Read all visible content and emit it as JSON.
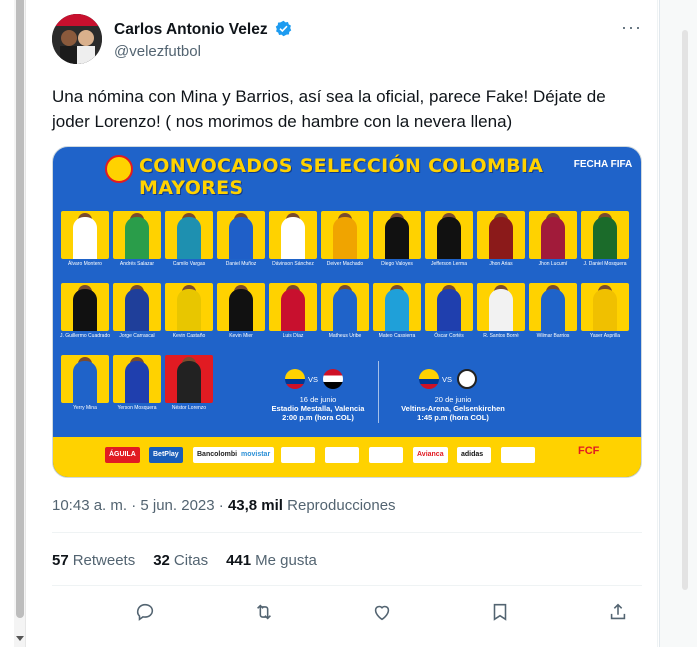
{
  "tweet": {
    "author_name": "Carlos Antonio Velez",
    "handle": "@velezfutbol",
    "text": "Una nómina con Mina y Barrios, así sea la oficial, parece Fake! Déjate de joder Lorenzo! ( nos morimos de hambre con la nevera llena)",
    "more_glyph": "···",
    "time": "10:43 a. m. · 5 jun. 2023 · ",
    "views_count": "43,8 mil",
    "views_label": " Reproducciones",
    "stats": [
      {
        "count": "57",
        "label": "Retweets"
      },
      {
        "count": "32",
        "label": "Citas"
      },
      {
        "count": "441",
        "label": "Me gusta"
      }
    ]
  },
  "actions": [
    {
      "name": "reply-icon"
    },
    {
      "name": "retweet-icon"
    },
    {
      "name": "like-icon"
    },
    {
      "name": "bookmark-icon"
    },
    {
      "name": "share-icon"
    }
  ],
  "media": {
    "title": "CONVOCADOS SELECCIÓN COLOMBIA MAYORES",
    "fecha": "FECHA FIFA",
    "players_row1": [
      "Álvaro Montero",
      "Andrés Salazar",
      "Camilo Vargas",
      "Daniel Muñoz",
      "Dávinson Sánchez",
      "Deiver Machado",
      "Diego Valoyes",
      "Jefferson Lerma",
      "Jhon Arias",
      "Jhon Lucumí",
      "J. Daniel Mosquera"
    ],
    "players_row2": [
      "J. Guillermo Cuadrado",
      "Jorge Carrascal",
      "Kevin Castaño",
      "Kevin Mier",
      "Luis Díaz",
      "Matheus Uribe",
      "Mateo Cassierra",
      "Óscar Cortés",
      "R. Santos Borré",
      "Wilmar Barrios",
      "Yaser Asprilla"
    ],
    "players_row3": [
      "Yerry Mina",
      "Yerson Mosquera",
      "Néstor Lorenzo"
    ],
    "match1": {
      "date": "16 de junio",
      "venue": "Estadio Mestalla, Valencia",
      "time": "2:00 p.m (hora COL)"
    },
    "match2": {
      "date": "20 de junio",
      "venue": "Veltins-Arena, Gelsenkirchen",
      "time": "1:45 p.m (hora COL)"
    },
    "sponsors": [
      "ÁGUILA",
      "BetPlay",
      "Bancolombia",
      "movistar",
      "",
      "",
      "",
      "Avianca",
      "adidas",
      ""
    ],
    "fcf": "FCF"
  },
  "colors": {
    "accent": "#1d9bf0",
    "secondary_text": "#536471",
    "banner_blue": "#1f63c9",
    "yellow": "#ffd200"
  }
}
